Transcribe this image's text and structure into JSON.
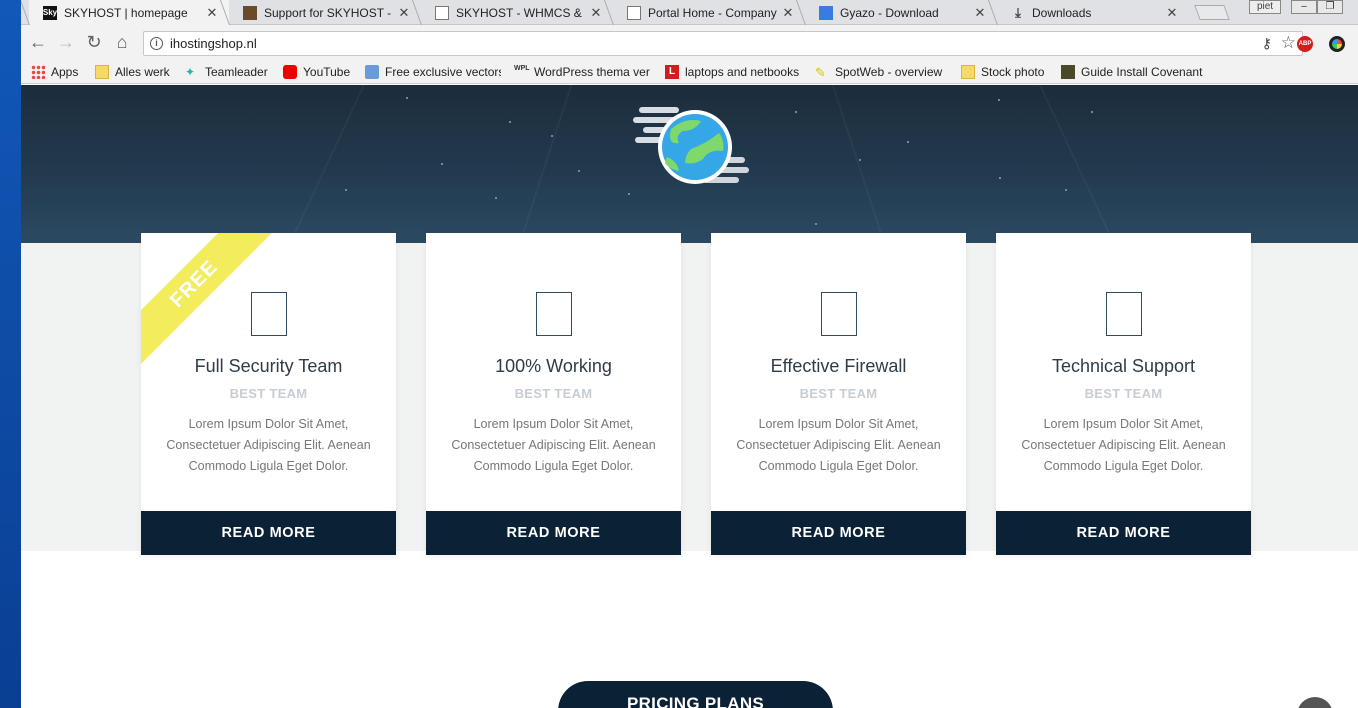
{
  "tabs": [
    {
      "title": "SKYHOST | homepage",
      "favicon_text": "Sky",
      "active": true
    },
    {
      "title": "Support for SKYHOST - W",
      "favicon_text": ""
    },
    {
      "title": "SKYHOST - WHMCS & H",
      "favicon_text": ""
    },
    {
      "title": "Portal Home - Company",
      "favicon_text": ""
    },
    {
      "title": "Gyazo - Download",
      "favicon_text": ""
    },
    {
      "title": "Downloads",
      "favicon_text": ""
    }
  ],
  "window": {
    "user_label": "piet"
  },
  "address_bar": {
    "url": "ihostingshop.nl"
  },
  "bookmarks": [
    {
      "label": "Apps",
      "icon": "apps-grid-icon"
    },
    {
      "label": "Alles werk",
      "icon": "folder-icon"
    },
    {
      "label": "Teamleader",
      "icon": "teamleader-icon"
    },
    {
      "label": "YouTube",
      "icon": "youtube-icon"
    },
    {
      "label": "Free exclusive vectors",
      "icon": "cloud-icon"
    },
    {
      "label": "WordPress thema ver",
      "icon": "wpl-icon"
    },
    {
      "label": "laptops and netbooks",
      "icon": "l-icon"
    },
    {
      "label": "SpotWeb - overview",
      "icon": "spot-icon"
    },
    {
      "label": "Stock photo",
      "icon": "folder-icon"
    },
    {
      "label": "Guide Install Covenant",
      "icon": "guide-icon"
    }
  ],
  "features": [
    {
      "title": "Full Security Team",
      "subtitle": "BEST TEAM",
      "description": "Lorem Ipsum Dolor Sit Amet, Consectetuer Adipiscing Elit. Aenean Commodo Ligula Eget Dolor.",
      "button": "READ MORE",
      "ribbon": "FREE"
    },
    {
      "title": "100% Working",
      "subtitle": "BEST TEAM",
      "description": "Lorem Ipsum Dolor Sit Amet, Consectetuer Adipiscing Elit. Aenean Commodo Ligula Eget Dolor.",
      "button": "READ MORE"
    },
    {
      "title": "Effective Firewall",
      "subtitle": "BEST TEAM",
      "description": "Lorem Ipsum Dolor Sit Amet, Consectetuer Adipiscing Elit. Aenean Commodo Ligula Eget Dolor.",
      "button": "READ MORE"
    },
    {
      "title": "Technical Support",
      "subtitle": "BEST TEAM",
      "description": "Lorem Ipsum Dolor Sit Amet, Consectetuer Adipiscing Elit. Aenean Commodo Ligula Eget Dolor.",
      "button": "READ MORE"
    }
  ],
  "pricing": {
    "label": "PRICING PLANS"
  },
  "colors": {
    "navy": "#0b2236",
    "ribbon": "#f3ec5c",
    "hero": "#223a4e"
  }
}
